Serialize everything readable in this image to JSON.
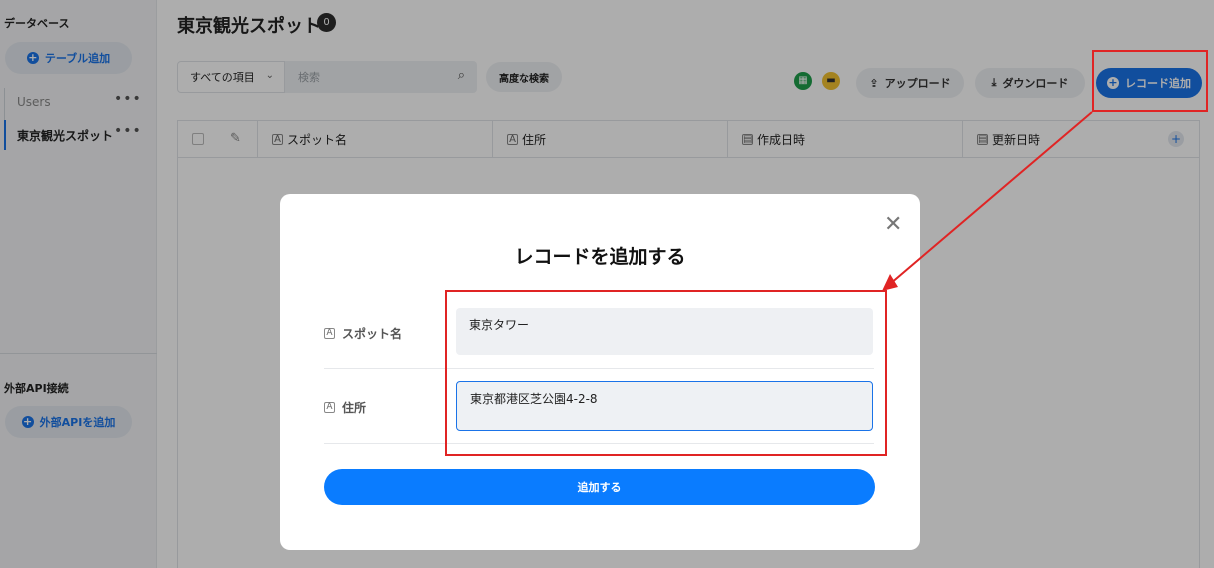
{
  "sidebar": {
    "database_title": "データベース",
    "add_table_label": "テーブル追加",
    "tables": [
      {
        "label": "Users"
      },
      {
        "label": "東京観光スポット"
      }
    ],
    "more_label": "•••",
    "external_api_title": "外部API接続",
    "add_external_api_label": "外部APIを追加"
  },
  "header": {
    "title": "東京観光スポット",
    "count": "0"
  },
  "toolbar": {
    "filter_value": "すべての項目",
    "search_placeholder": "検索",
    "advanced_search_label": "高度な検索",
    "upload_label": "アップロード",
    "download_label": "ダウンロード",
    "add_record_label": "レコード追加"
  },
  "table": {
    "columns": [
      {
        "label": "スポット名",
        "type_icon": "A"
      },
      {
        "label": "住所",
        "type_icon": "A"
      },
      {
        "label": "作成日時",
        "type_icon": "calendar"
      },
      {
        "label": "更新日時",
        "type_icon": "calendar"
      }
    ]
  },
  "modal": {
    "title": "レコードを追加する",
    "fields": [
      {
        "label": "スポット名",
        "value": "東京タワー"
      },
      {
        "label": "住所",
        "value": "東京都港区芝公園4-2-8"
      }
    ],
    "submit_label": "追加する"
  },
  "colors": {
    "accent": "#1a73e8",
    "submit": "#0a7cff",
    "annotation": "#e02424"
  }
}
